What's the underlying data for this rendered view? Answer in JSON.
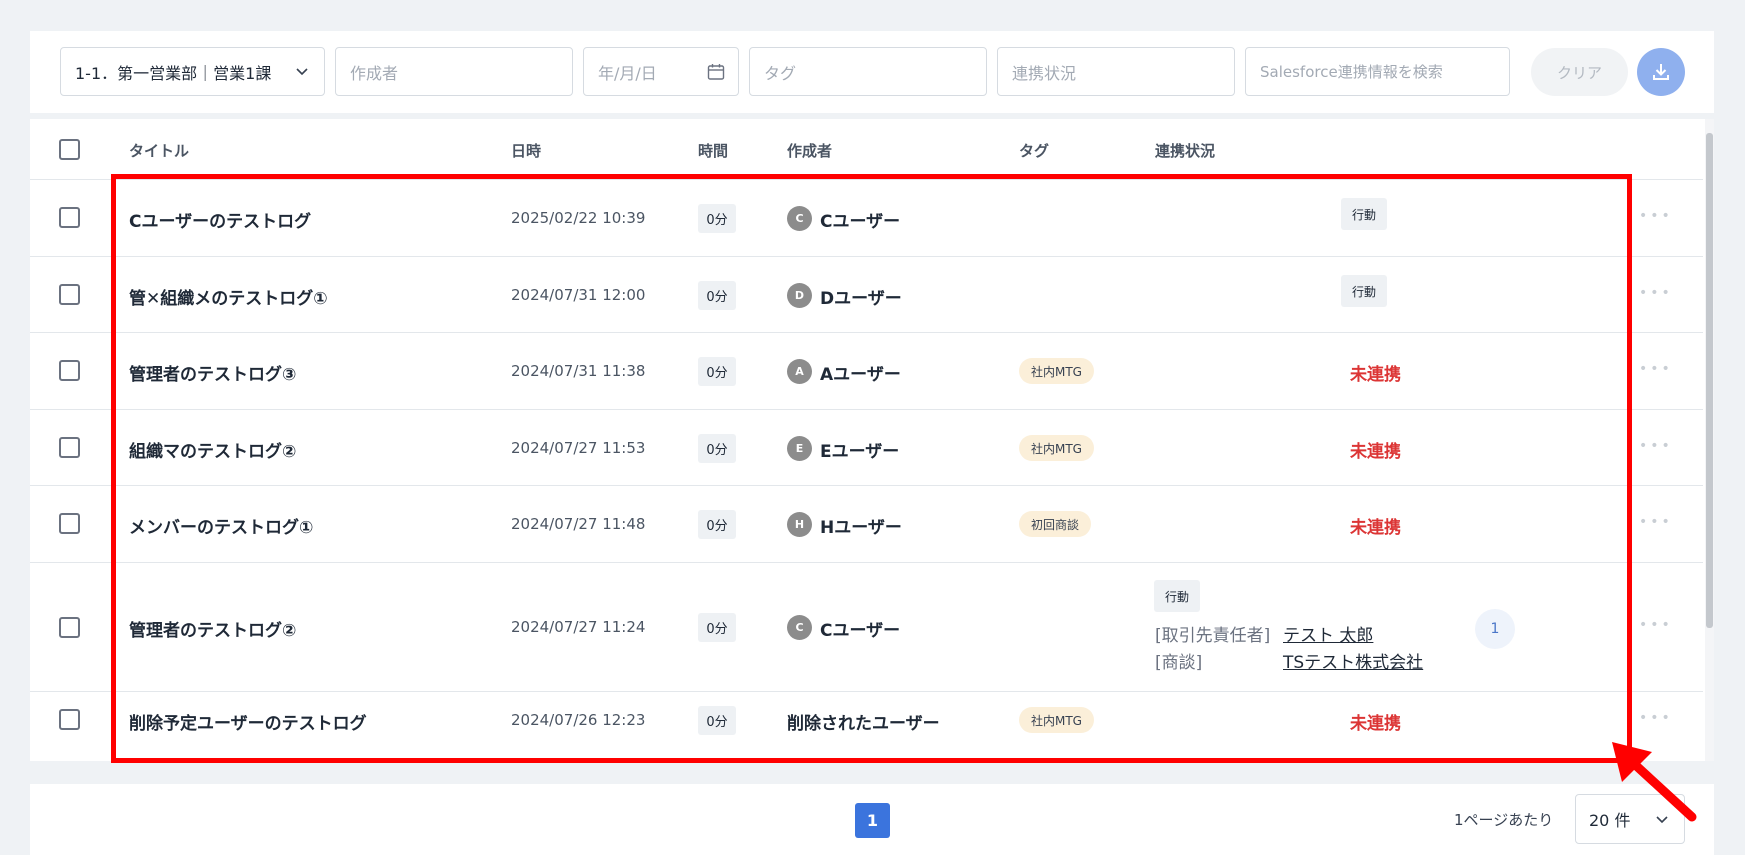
{
  "filters": {
    "department": "1-1．第一営業部｜営業1課",
    "creator_placeholder": "作成者",
    "date_placeholder": "年/月/日",
    "tag_placeholder": "タグ",
    "status_placeholder": "連携状況",
    "salesforce_placeholder": "Salesforce連携情報を検索",
    "clear_label": "クリア"
  },
  "table": {
    "headers": {
      "title": "タイトル",
      "datetime": "日時",
      "duration": "時間",
      "author": "作成者",
      "tag": "タグ",
      "status": "連携状況"
    },
    "rows": [
      {
        "title": "Cユーザーのテストログ",
        "datetime": "2025/02/22 10:39",
        "duration": "0分",
        "avatar": "C",
        "author": "Cユーザー",
        "tag": "",
        "action": "行動",
        "status": ""
      },
      {
        "title": "管✕組織メのテストログ①",
        "datetime": "2024/07/31 12:00",
        "duration": "0分",
        "avatar": "D",
        "author": "Dユーザー",
        "tag": "",
        "action": "行動",
        "status": ""
      },
      {
        "title": "管理者のテストログ③",
        "datetime": "2024/07/31 11:38",
        "duration": "0分",
        "avatar": "A",
        "author": "Aユーザー",
        "tag": "社内MTG",
        "action": "",
        "status": "未連携"
      },
      {
        "title": "組織マのテストログ②",
        "datetime": "2024/07/27 11:53",
        "duration": "0分",
        "avatar": "E",
        "author": "Eユーザー",
        "tag": "社内MTG",
        "action": "",
        "status": "未連携"
      },
      {
        "title": "メンバーのテストログ①",
        "datetime": "2024/07/27 11:48",
        "duration": "0分",
        "avatar": "H",
        "author": "Hユーザー",
        "tag": "初回商談",
        "action": "",
        "status": "未連携"
      },
      {
        "title": "管理者のテストログ②",
        "datetime": "2024/07/27 11:24",
        "duration": "0分",
        "avatar": "C",
        "author": "Cユーザー",
        "tag": "",
        "action": "行動",
        "links": [
          {
            "label": "[取引先責任者]",
            "value": "テスト 太郎"
          },
          {
            "label": "[商談]",
            "value": "TSテスト株式会社"
          }
        ],
        "count": "1"
      },
      {
        "title": "削除予定ユーザーのテストログ",
        "datetime": "2024/07/26 12:23",
        "duration": "0分",
        "avatar": "",
        "author": "削除されたユーザー",
        "tag": "社内MTG",
        "action": "",
        "status": "未連携"
      }
    ]
  },
  "pagination": {
    "current_page": "1",
    "per_page_label": "1ページあたり",
    "per_page_value": "20 件"
  },
  "colors": {
    "accent": "#3b74dd",
    "unlinked": "#dc3535",
    "highlight": "#ff0000"
  }
}
